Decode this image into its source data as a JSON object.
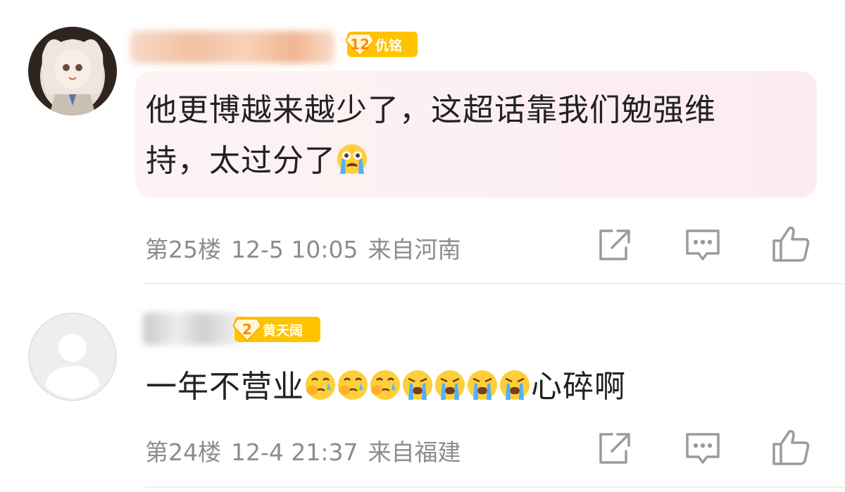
{
  "comments": [
    {
      "badge": {
        "level": "12",
        "title": "仇铭"
      },
      "text_line1": "他更博越来越少了，这超话靠我们勉强维",
      "text_line2": "持，太过分了",
      "emojis": [
        "loudly-crying-face-emoji"
      ],
      "floor": "第25楼",
      "time": "12-5 10:05",
      "location": "来自河南"
    },
    {
      "badge": {
        "level": "2",
        "title": "黄天阔"
      },
      "text_before": "一年不营业",
      "emojis": [
        "crying-pinch-face-emoji",
        "crying-pinch-face-emoji",
        "crying-pinch-face-emoji",
        "crying-face-emoji",
        "crying-face-emoji",
        "crying-face-emoji",
        "crying-face-emoji"
      ],
      "text_after": "心碎啊",
      "floor": "第24楼",
      "time": "12-4 21:37",
      "location": "来自福建"
    }
  ],
  "colors": {
    "badge_bg": "#ffc300",
    "badge_level_text": "#ff8a00",
    "meta_text": "#8c8c8c",
    "icon_stroke": "#9b9b9b",
    "bubble_bg": "#fcecef"
  }
}
